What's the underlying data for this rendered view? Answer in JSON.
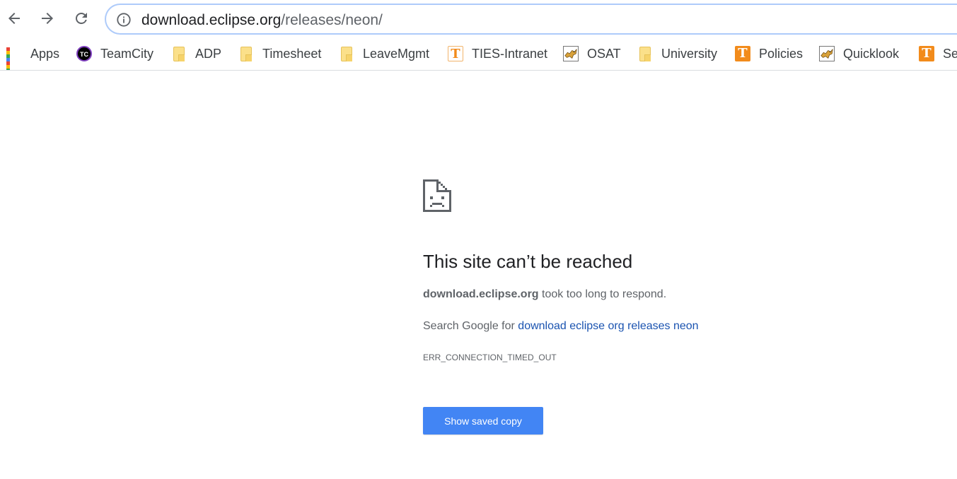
{
  "toolbar": {
    "back_icon": "arrow-left-icon",
    "forward_icon": "arrow-right-icon",
    "reload_icon": "reload-icon",
    "info_icon": "info-circle-icon",
    "url_host": "download.eclipse.org",
    "url_path": "/releases/neon/"
  },
  "bookmarks": [
    {
      "label": "Apps",
      "icon": "apps-grid-icon"
    },
    {
      "label": "TeamCity",
      "icon": "teamcity-icon",
      "icon_text": "TC"
    },
    {
      "label": "ADP",
      "icon": "folder-icon"
    },
    {
      "label": "Timesheet",
      "icon": "folder-icon"
    },
    {
      "label": "LeaveMgmt",
      "icon": "folder-icon"
    },
    {
      "label": "TIES-Intranet",
      "icon": "t-logo-icon",
      "icon_text": "T"
    },
    {
      "label": "OSAT",
      "icon": "tomcat-icon"
    },
    {
      "label": "University",
      "icon": "folder-icon"
    },
    {
      "label": "Policies",
      "icon": "t-logo-icon",
      "icon_text": "T"
    },
    {
      "label": "Quicklook",
      "icon": "tomcat-icon"
    },
    {
      "label": "Se",
      "icon": "t-logo-icon",
      "icon_text": "T"
    }
  ],
  "error": {
    "icon": "sad-page-icon",
    "title": "This site can’t be reached",
    "host": "download.eclipse.org",
    "message_suffix": " took too long to respond.",
    "search_prefix": "Search Google for ",
    "search_link": "download eclipse org releases neon",
    "code": "ERR_CONNECTION_TIMED_OUT",
    "button_label": "Show saved copy"
  },
  "colors": {
    "accent_blue": "#4285f4",
    "link_blue": "#1a53b0",
    "folder_yellow": "#fbe08a",
    "t_logo_orange": "#f28b1b"
  }
}
